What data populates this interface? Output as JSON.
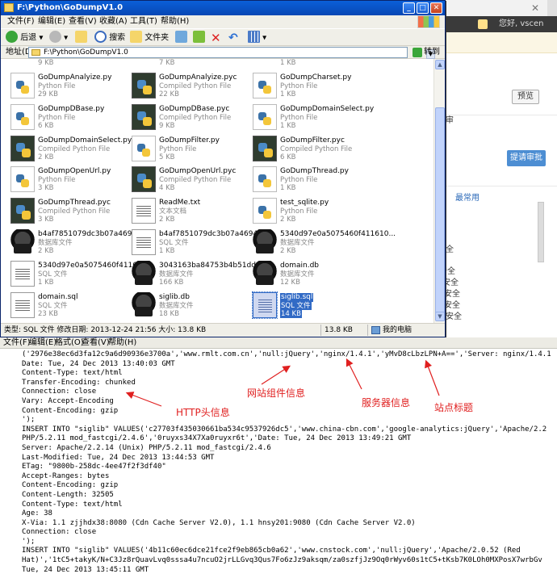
{
  "background_browser": {
    "user_text": "您好, vscen",
    "buttons": {
      "preview": "预览",
      "submit": "提请审批"
    },
    "texts": [
      "审",
      "最常用",
      "全",
      "安全",
      "安全",
      "安全",
      "安全",
      "安全"
    ]
  },
  "explorer": {
    "title": "F:\\Python\\GoDumpV1.0",
    "menu": [
      "文件(F)",
      "编辑(E)",
      "查看(V)",
      "收藏(A)",
      "工具(T)",
      "帮助(H)"
    ],
    "toolbar": {
      "back": "后退",
      "search": "搜索",
      "folders": "文件夹"
    },
    "address": {
      "label": "地址(D)",
      "value": "F:\\Python\\GoDumpV1.0",
      "go": "转到"
    },
    "partial_sizes": [
      "9 KB",
      "7 KB",
      "1 KB"
    ],
    "files": [
      {
        "name": "GoDumpAnalyize.py",
        "type": "Python File",
        "size": "29 KB",
        "icon": "python-file-icon"
      },
      {
        "name": "GoDumpAnalyize.pyc",
        "type": "Compiled Python File",
        "size": "22 KB",
        "icon": "compiled-python-icon"
      },
      {
        "name": "GoDumpCharset.py",
        "type": "Python File",
        "size": "1 KB",
        "icon": "python-file-icon"
      },
      {
        "name": "GoDumpDBase.py",
        "type": "Python File",
        "size": "6 KB",
        "icon": "python-file-icon"
      },
      {
        "name": "GoDumpDBase.pyc",
        "type": "Compiled Python File",
        "size": "9 KB",
        "icon": "compiled-python-icon"
      },
      {
        "name": "GoDumpDomainSelect.py",
        "type": "Python File",
        "size": "1 KB",
        "icon": "python-file-icon"
      },
      {
        "name": "GoDumpDomainSelect.pyc",
        "type": "Compiled Python File",
        "size": "2 KB",
        "icon": "compiled-python-icon"
      },
      {
        "name": "GoDumpFilter.py",
        "type": "Python File",
        "size": "5 KB",
        "icon": "python-file-icon"
      },
      {
        "name": "GoDumpFilter.pyc",
        "type": "Compiled Python File",
        "size": "6 KB",
        "icon": "compiled-python-icon"
      },
      {
        "name": "GoDumpOpenUrl.py",
        "type": "Python File",
        "size": "3 KB",
        "icon": "python-file-icon"
      },
      {
        "name": "GoDumpOpenUrl.pyc",
        "type": "Compiled Python File",
        "size": "4 KB",
        "icon": "compiled-python-icon"
      },
      {
        "name": "GoDumpThread.py",
        "type": "Python File",
        "size": "1 KB",
        "icon": "python-file-icon"
      },
      {
        "name": "GoDumpThread.pyc",
        "type": "Compiled Python File",
        "size": "3 KB",
        "icon": "compiled-python-icon"
      },
      {
        "name": "ReadMe.txt",
        "type": "文本文档",
        "size": "2 KB",
        "icon": "text-file-icon"
      },
      {
        "name": "test_sqlite.py",
        "type": "Python File",
        "size": "2 KB",
        "icon": "python-file-icon"
      },
      {
        "name": "b4af7851079dc3b07a4694acf...",
        "type": "数据库文件",
        "size": "2 KB",
        "icon": "database-file-icon"
      },
      {
        "name": "b4af7851079dc3b07a4694acf...",
        "type": "SQL 文件",
        "size": "1 KB",
        "icon": "sql-file-icon"
      },
      {
        "name": "5340d97e0a5075460f411610...",
        "type": "数据库文件",
        "size": "2 KB",
        "icon": "database-file-icon"
      },
      {
        "name": "5340d97e0a5075460f411610...",
        "type": "SQL 文件",
        "size": "1 KB",
        "icon": "sql-file-icon"
      },
      {
        "name": "3043163ba84753b4b51dd329...",
        "type": "数据库文件",
        "size": "166 KB",
        "icon": "database-file-icon"
      },
      {
        "name": "domain.db",
        "type": "数据库文件",
        "size": "12 KB",
        "icon": "database-file-icon"
      },
      {
        "name": "domain.sql",
        "type": "SQL 文件",
        "size": "23 KB",
        "icon": "sql-file-icon"
      },
      {
        "name": "siglib.db",
        "type": "数据库文件",
        "size": "18 KB",
        "icon": "database-file-icon"
      },
      {
        "name": "siglib.sql",
        "type": "SQL 文件",
        "size": "14 KB",
        "icon": "sql-file-icon",
        "selected": true
      }
    ],
    "status": {
      "left": "类型: SQL 文件 修改日期: 2013-12-24 21:56 大小: 13.8 KB",
      "size": "13.8 KB",
      "location": "我的电脑"
    }
  },
  "notepad": {
    "menu": [
      "文件(F)",
      "编辑(E)",
      "格式(O)",
      "查看(V)",
      "帮助(H)"
    ],
    "lines": [
      "('2976e38ec6d3fa12c9a6d90936e3700a','www.rmlt.com.cn','null:jQuery','nginx/1.4.1','yMvD8cLbzLPN+A==','Server: nginx/1.4.1",
      "Date: Tue, 24 Dec 2013 13:40:03 GMT",
      "Content-Type: text/html",
      "Transfer-Encoding: chunked",
      "Connection: close",
      "Vary: Accept-Encoding",
      "Content-Encoding: gzip",
      "');",
      "INSERT INTO \"siglib\" VALUES('c27703f435030661ba534c9537926dc5','www.china-cbn.com','google-analytics:jQuery','Apache/2.2",
      "PHP/5.2.11 mod_fastcgi/2.4.6','0ruyxs34X7Xa0ruyxr6t','Date: Tue, 24 Dec 2013 13:49:21 GMT",
      "Server: Apache/2.2.14 (Unix) PHP/5.2.11 mod_fastcgi/2.4.6",
      "Last-Modified: Tue, 24 Dec 2013 13:44:53 GMT",
      "ETag: \"9800b-258dc-4ee47f2f3df40\"",
      "Accept-Ranges: bytes",
      "Content-Encoding: gzip",
      "Content-Length: 32505",
      "Content-Type: text/html",
      "Age: 38",
      "X-Via: 1.1 zjjhdx38:8080 (Cdn Cache Server V2.0), 1.1 hnsy201:9080 (Cdn Cache Server V2.0)",
      "Connection: close",
      "');",
      "INSERT INTO \"siglib\" VALUES('4b11c60ec6dce21fce2f9eb865cb0a62','www.cnstock.com','null:jQuery','Apache/2.0.52 (Red",
      "Hat)','1tC5+takyK/N+C3Jz8rQuavLvq0sssa4u7ncuO2jrLLGvq3Qus7Fo6zJz9aksqm/za0szfjJz9Oq0rWyv60s1tC5+tKsb7K0LOh0MXPosX7wrbGv",
      "Tue, 24 Dec 2013 13:45:11 GMT",
      "Server: Apache/2.0.52 (Red Hat)"
    ]
  },
  "annotations": {
    "http_header": "HTTP头信息",
    "site_component": "网站组件信息",
    "server_info": "服务器信息",
    "site_title": "站点标题"
  },
  "colors": {
    "annotation": "#e02020",
    "title_bar": "#0a5fd8",
    "selection": "#316ac5"
  }
}
